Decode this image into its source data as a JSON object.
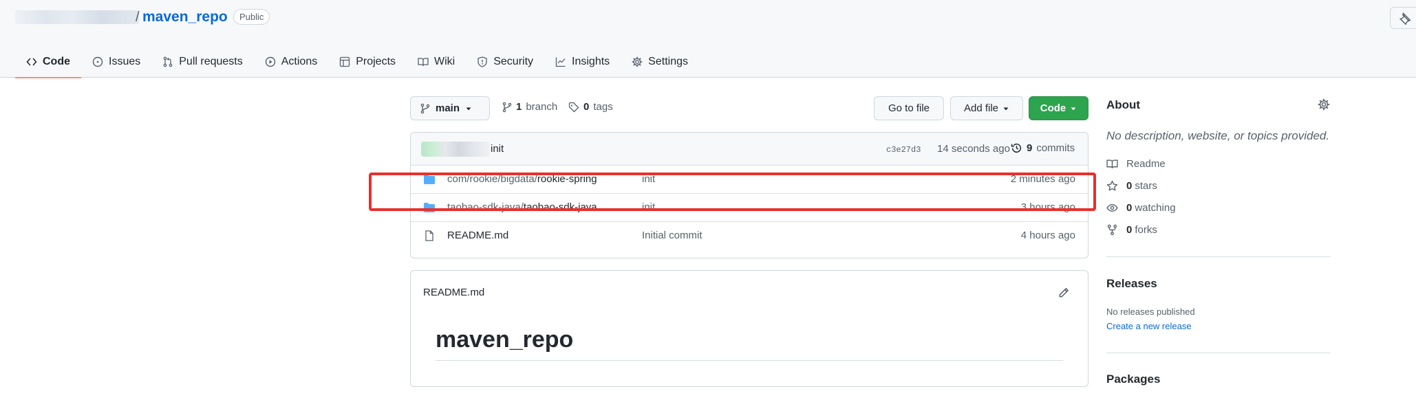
{
  "header": {
    "repo_separator": "/",
    "repo_name": "maven_repo",
    "visibility_badge": "Public"
  },
  "tabs": [
    {
      "label": "Code",
      "icon": "code-icon",
      "active": true
    },
    {
      "label": "Issues",
      "icon": "issue-opened-icon"
    },
    {
      "label": "Pull requests",
      "icon": "git-pull-request-icon"
    },
    {
      "label": "Actions",
      "icon": "play-icon"
    },
    {
      "label": "Projects",
      "icon": "table-icon"
    },
    {
      "label": "Wiki",
      "icon": "book-icon"
    },
    {
      "label": "Security",
      "icon": "shield-icon"
    },
    {
      "label": "Insights",
      "icon": "graph-icon"
    },
    {
      "label": "Settings",
      "icon": "gear-icon"
    }
  ],
  "file_nav": {
    "branch": "main",
    "branch_count": "1",
    "branch_label": "branch",
    "tag_count": "0",
    "tag_label": "tags",
    "goto_file": "Go to file",
    "add_file": "Add file",
    "code_button": "Code"
  },
  "commit": {
    "message": "init",
    "sha": "c3e27d3",
    "time": "14 seconds ago",
    "count": "9",
    "count_label": "commits"
  },
  "files": [
    {
      "type": "folder",
      "path_prefix": "com/rookie/bigdata/",
      "name": "rookie-spring",
      "message": "init",
      "time": "2 minutes ago"
    },
    {
      "type": "folder",
      "path_prefix": "taobao-sdk-java/",
      "name": "taobao-sdk-java",
      "message": "init",
      "time": "3 hours ago"
    },
    {
      "type": "file",
      "path_prefix": "",
      "name": "README.md",
      "message": "Initial commit",
      "time": "4 hours ago"
    }
  ],
  "readme": {
    "title": "README.md",
    "heading": "maven_repo"
  },
  "about": {
    "title": "About",
    "description": "No description, website, or topics provided.",
    "readme_label": "Readme",
    "stars_count": "0",
    "stars_label": "stars",
    "watching_count": "0",
    "watching_label": "watching",
    "forks_count": "0",
    "forks_label": "forks"
  },
  "releases": {
    "title": "Releases",
    "none_text": "No releases published",
    "create_link": "Create a new release"
  },
  "packages": {
    "title": "Packages"
  },
  "colors": {
    "accent_link": "#0969da",
    "code_button": "#2da44e",
    "active_tab_underline": "#fd8c73",
    "highlight_box": "#e8302c",
    "folder_icon": "#54aeff"
  }
}
